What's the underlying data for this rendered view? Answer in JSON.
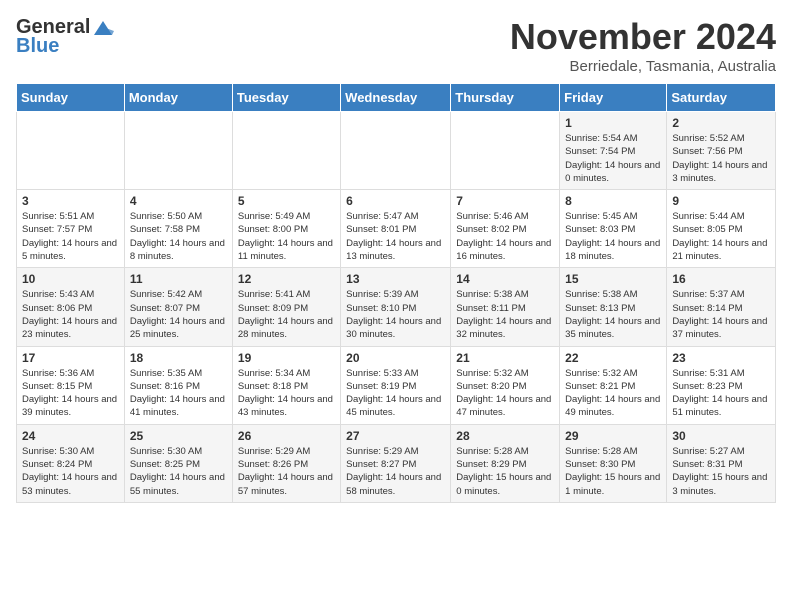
{
  "logo": {
    "general": "General",
    "blue": "Blue"
  },
  "title": "November 2024",
  "subtitle": "Berriedale, Tasmania, Australia",
  "days_header": [
    "Sunday",
    "Monday",
    "Tuesday",
    "Wednesday",
    "Thursday",
    "Friday",
    "Saturday"
  ],
  "weeks": [
    [
      {
        "day": "",
        "info": ""
      },
      {
        "day": "",
        "info": ""
      },
      {
        "day": "",
        "info": ""
      },
      {
        "day": "",
        "info": ""
      },
      {
        "day": "",
        "info": ""
      },
      {
        "day": "1",
        "info": "Sunrise: 5:54 AM\nSunset: 7:54 PM\nDaylight: 14 hours and 0 minutes."
      },
      {
        "day": "2",
        "info": "Sunrise: 5:52 AM\nSunset: 7:56 PM\nDaylight: 14 hours and 3 minutes."
      }
    ],
    [
      {
        "day": "3",
        "info": "Sunrise: 5:51 AM\nSunset: 7:57 PM\nDaylight: 14 hours and 5 minutes."
      },
      {
        "day": "4",
        "info": "Sunrise: 5:50 AM\nSunset: 7:58 PM\nDaylight: 14 hours and 8 minutes."
      },
      {
        "day": "5",
        "info": "Sunrise: 5:49 AM\nSunset: 8:00 PM\nDaylight: 14 hours and 11 minutes."
      },
      {
        "day": "6",
        "info": "Sunrise: 5:47 AM\nSunset: 8:01 PM\nDaylight: 14 hours and 13 minutes."
      },
      {
        "day": "7",
        "info": "Sunrise: 5:46 AM\nSunset: 8:02 PM\nDaylight: 14 hours and 16 minutes."
      },
      {
        "day": "8",
        "info": "Sunrise: 5:45 AM\nSunset: 8:03 PM\nDaylight: 14 hours and 18 minutes."
      },
      {
        "day": "9",
        "info": "Sunrise: 5:44 AM\nSunset: 8:05 PM\nDaylight: 14 hours and 21 minutes."
      }
    ],
    [
      {
        "day": "10",
        "info": "Sunrise: 5:43 AM\nSunset: 8:06 PM\nDaylight: 14 hours and 23 minutes."
      },
      {
        "day": "11",
        "info": "Sunrise: 5:42 AM\nSunset: 8:07 PM\nDaylight: 14 hours and 25 minutes."
      },
      {
        "day": "12",
        "info": "Sunrise: 5:41 AM\nSunset: 8:09 PM\nDaylight: 14 hours and 28 minutes."
      },
      {
        "day": "13",
        "info": "Sunrise: 5:39 AM\nSunset: 8:10 PM\nDaylight: 14 hours and 30 minutes."
      },
      {
        "day": "14",
        "info": "Sunrise: 5:38 AM\nSunset: 8:11 PM\nDaylight: 14 hours and 32 minutes."
      },
      {
        "day": "15",
        "info": "Sunrise: 5:38 AM\nSunset: 8:13 PM\nDaylight: 14 hours and 35 minutes."
      },
      {
        "day": "16",
        "info": "Sunrise: 5:37 AM\nSunset: 8:14 PM\nDaylight: 14 hours and 37 minutes."
      }
    ],
    [
      {
        "day": "17",
        "info": "Sunrise: 5:36 AM\nSunset: 8:15 PM\nDaylight: 14 hours and 39 minutes."
      },
      {
        "day": "18",
        "info": "Sunrise: 5:35 AM\nSunset: 8:16 PM\nDaylight: 14 hours and 41 minutes."
      },
      {
        "day": "19",
        "info": "Sunrise: 5:34 AM\nSunset: 8:18 PM\nDaylight: 14 hours and 43 minutes."
      },
      {
        "day": "20",
        "info": "Sunrise: 5:33 AM\nSunset: 8:19 PM\nDaylight: 14 hours and 45 minutes."
      },
      {
        "day": "21",
        "info": "Sunrise: 5:32 AM\nSunset: 8:20 PM\nDaylight: 14 hours and 47 minutes."
      },
      {
        "day": "22",
        "info": "Sunrise: 5:32 AM\nSunset: 8:21 PM\nDaylight: 14 hours and 49 minutes."
      },
      {
        "day": "23",
        "info": "Sunrise: 5:31 AM\nSunset: 8:23 PM\nDaylight: 14 hours and 51 minutes."
      }
    ],
    [
      {
        "day": "24",
        "info": "Sunrise: 5:30 AM\nSunset: 8:24 PM\nDaylight: 14 hours and 53 minutes."
      },
      {
        "day": "25",
        "info": "Sunrise: 5:30 AM\nSunset: 8:25 PM\nDaylight: 14 hours and 55 minutes."
      },
      {
        "day": "26",
        "info": "Sunrise: 5:29 AM\nSunset: 8:26 PM\nDaylight: 14 hours and 57 minutes."
      },
      {
        "day": "27",
        "info": "Sunrise: 5:29 AM\nSunset: 8:27 PM\nDaylight: 14 hours and 58 minutes."
      },
      {
        "day": "28",
        "info": "Sunrise: 5:28 AM\nSunset: 8:29 PM\nDaylight: 15 hours and 0 minutes."
      },
      {
        "day": "29",
        "info": "Sunrise: 5:28 AM\nSunset: 8:30 PM\nDaylight: 15 hours and 1 minute."
      },
      {
        "day": "30",
        "info": "Sunrise: 5:27 AM\nSunset: 8:31 PM\nDaylight: 15 hours and 3 minutes."
      }
    ]
  ]
}
